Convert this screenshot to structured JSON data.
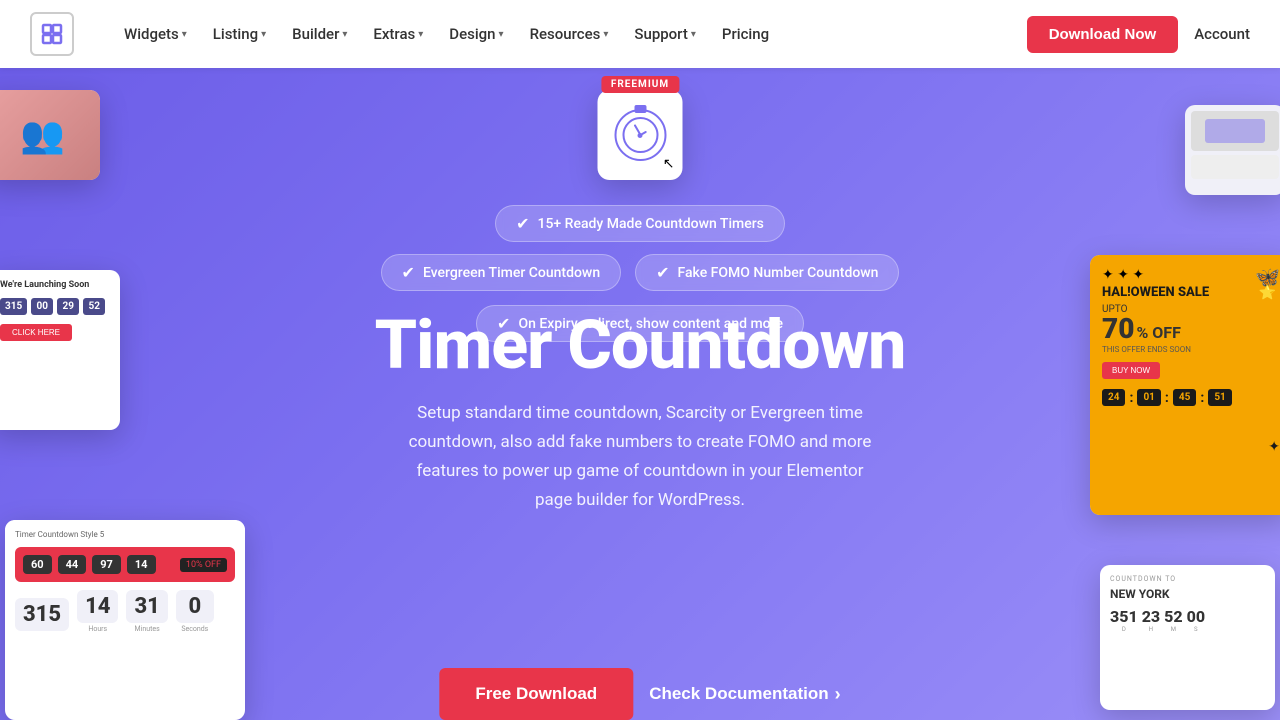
{
  "nav": {
    "logo_symbol": "≡",
    "items": [
      {
        "label": "Widgets",
        "has_dropdown": true
      },
      {
        "label": "Listing",
        "has_dropdown": true
      },
      {
        "label": "Builder",
        "has_dropdown": true
      },
      {
        "label": "Extras",
        "has_dropdown": true
      },
      {
        "label": "Design",
        "has_dropdown": true
      },
      {
        "label": "Resources",
        "has_dropdown": true
      },
      {
        "label": "Support",
        "has_dropdown": true
      },
      {
        "label": "Pricing",
        "has_dropdown": false
      }
    ],
    "download_btn": "Download Now",
    "account_btn": "Account"
  },
  "hero": {
    "freemium_badge": "FREEMIUM",
    "features": [
      {
        "text": "15+ Ready Made Countdown Timers"
      },
      {
        "text": "Evergreen Timer Countdown"
      },
      {
        "text": "Fake FOMO Number Countdown"
      },
      {
        "text": "On Expiry redirect, show content and more"
      }
    ],
    "title": "Timer Countdown",
    "description": "Setup standard time countdown, Scarcity or Evergreen time countdown, also add fake numbers to create FOMO and more features to power up game of countdown in your Elementor page builder for WordPress.",
    "btn_free_download": "Free Download",
    "btn_check_docs": "Check Documentation"
  },
  "preview_cards": {
    "mid_left": {
      "title": "We're Launching Soon",
      "counts": [
        "315",
        "00",
        "29",
        "52"
      ],
      "btn": "CLICK HERE"
    },
    "bottom_left": {
      "label": "Timer Countdown Style 5",
      "counts": [
        "315",
        "14",
        "31",
        "0"
      ],
      "labels": [
        "",
        "Hours",
        "Minutes",
        "Seconds"
      ]
    },
    "halloween": {
      "sale": "Hal!oween Sale",
      "upto": "UPTO",
      "percent": "70",
      "off": "% OFF",
      "counts": [
        "24",
        "01",
        "45",
        "51"
      ]
    },
    "bottom_right": {
      "title": "COUNTDOWN TO",
      "city": "NEW YORK",
      "counts": [
        "351",
        "23",
        "52",
        "00"
      ]
    }
  },
  "colors": {
    "hero_bg": "#7b6ff0",
    "accent": "#e8354a",
    "white": "#ffffff",
    "pill_bg": "rgba(255,255,255,0.18)"
  }
}
